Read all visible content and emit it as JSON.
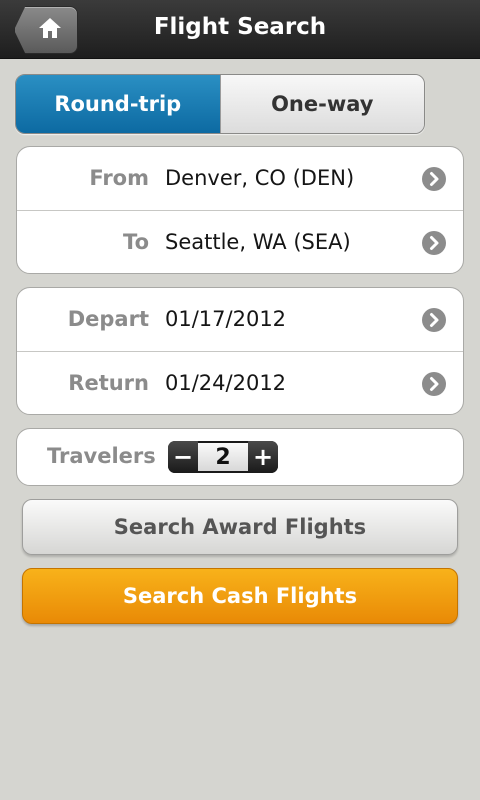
{
  "header": {
    "title": "Flight Search",
    "home_icon": "home-icon"
  },
  "trip_type": {
    "options": [
      "Round-trip",
      "One-way"
    ],
    "selected": "Round-trip",
    "active_color": "#0d6aa2"
  },
  "route": {
    "from_label": "From",
    "from_value": "Denver, CO (DEN)",
    "to_label": "To",
    "to_value": "Seattle, WA (SEA)"
  },
  "dates": {
    "depart_label": "Depart",
    "depart_value": "01/17/2012",
    "return_label": "Return",
    "return_value": "01/24/2012"
  },
  "travelers": {
    "label": "Travelers",
    "value": "2",
    "decrement": "−",
    "increment": "+"
  },
  "actions": {
    "award_label": "Search Award Flights",
    "cash_label": "Search Cash Flights",
    "cash_color": "#f0a010"
  }
}
